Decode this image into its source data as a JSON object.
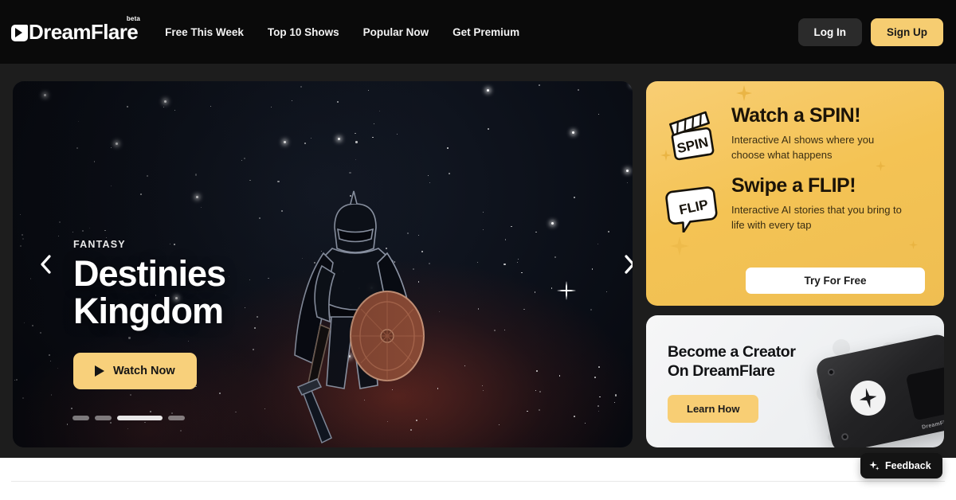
{
  "brand": {
    "name": "DreamFlare",
    "badge": "beta",
    "mark_icon": "dreamflare-logo-icon"
  },
  "nav": {
    "links": [
      {
        "label": "Free This Week"
      },
      {
        "label": "Top 10 Shows"
      },
      {
        "label": "Popular Now"
      },
      {
        "label": "Get Premium"
      }
    ],
    "login_label": "Log In",
    "signup_label": "Sign Up"
  },
  "hero": {
    "genre": "FANTASY",
    "title": "Destinies Kingdom",
    "watch_label": "Watch Now",
    "prev_icon": "chevron-left-icon",
    "next_icon": "chevron-right-icon",
    "play_icon": "play-icon",
    "slides_total": 4,
    "active_slide": 3
  },
  "promo": {
    "items": [
      {
        "icon": "clapperboard-spin-icon",
        "icon_label": "SPIN",
        "heading": "Watch a SPIN!",
        "body": "Interactive AI shows where you choose what happens"
      },
      {
        "icon": "speech-bubble-flip-icon",
        "icon_label": "FLIP",
        "heading": "Swipe a FLIP!",
        "body": "Interactive AI stories that you bring to life with every tap"
      }
    ],
    "cta_label": "Try For Free"
  },
  "creator": {
    "heading_line1": "Become a Creator",
    "heading_line2": "On DreamFlare",
    "cta_label": "Learn How",
    "device_label": "DreamFlare"
  },
  "feedback": {
    "label": "Feedback",
    "icon": "sparkle-icon"
  },
  "colors": {
    "brand_yellow": "#F5C85E",
    "promo_yellow": "#F4C354",
    "nav_bg": "#0a0a0a",
    "page_bg": "#1d1d1d",
    "creator_bg": "#eef0f2"
  }
}
